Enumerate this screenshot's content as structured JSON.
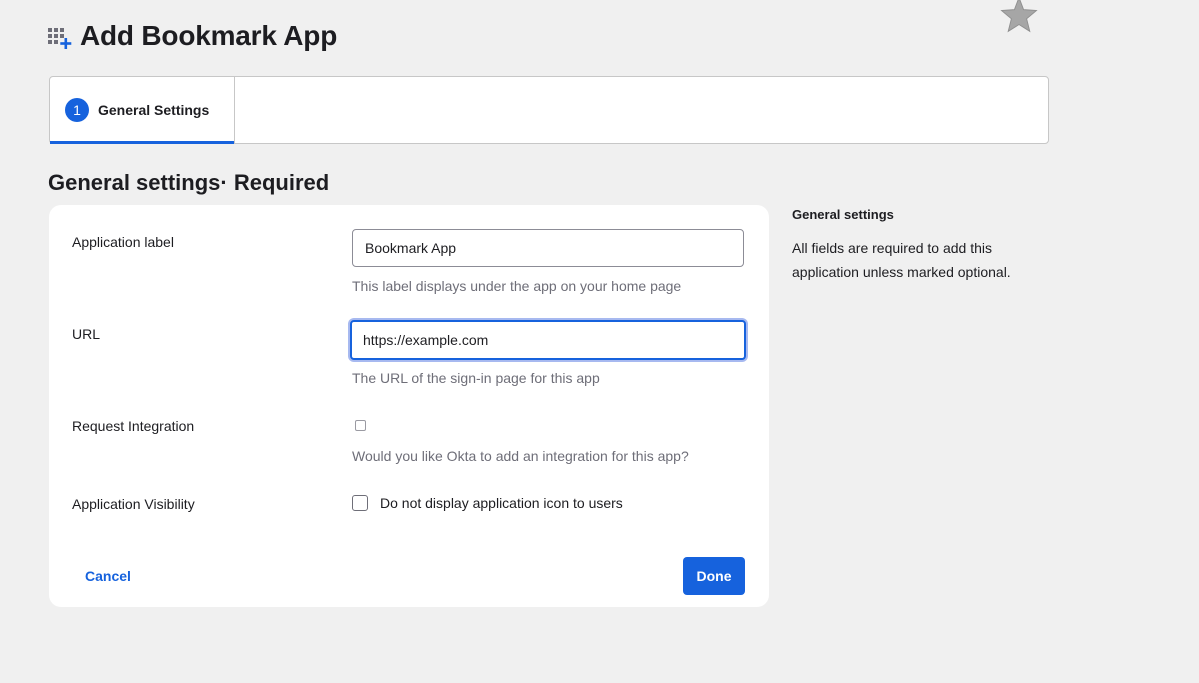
{
  "header": {
    "title": "Add Bookmark App",
    "icon": "apps-add-icon"
  },
  "stepper": {
    "steps": [
      {
        "number": "1",
        "label": "General Settings",
        "active": true
      }
    ]
  },
  "section": {
    "title": "General settings· Required"
  },
  "form": {
    "app_label": {
      "label": "Application label",
      "value": "Bookmark App",
      "hint": "This label displays under the app on your home page"
    },
    "url": {
      "label": "URL",
      "value": "https://example.com",
      "hint": "The URL of the sign-in page for this app"
    },
    "request_integration": {
      "label": "Request Integration",
      "checked": false,
      "hint": "Would you like Okta to add an integration for this app?"
    },
    "visibility": {
      "label": "Application Visibility",
      "checkbox_label": "Do not display application icon to users",
      "checked": false
    },
    "cancel_label": "Cancel",
    "done_label": "Done"
  },
  "side_panel": {
    "title": "General settings",
    "text": "All fields are required to add this application unless marked optional."
  },
  "colors": {
    "accent": "#1662dd",
    "background": "#f0f0f0",
    "card": "#ffffff"
  }
}
